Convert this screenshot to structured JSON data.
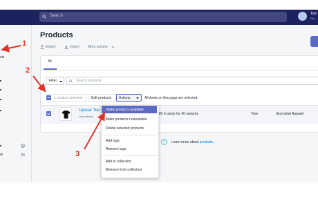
{
  "topbar": {
    "search_placeholder": "Search",
    "user_name": "Tom",
    "user_shop": "Sky"
  },
  "sidebar": {
    "items": [
      {
        "label": "cts"
      },
      {
        "label": "re"
      }
    ]
  },
  "page": {
    "title": "Products",
    "export_label": "Export",
    "import_label": "Import",
    "more_actions_label": "More actions"
  },
  "tabs": [
    {
      "label": "All"
    }
  ],
  "filter": {
    "label": "Filter",
    "search_placeholder": "Search products"
  },
  "bulk": {
    "selected_count": "1 product selected",
    "edit_label": "Edit products",
    "actions_label": "Actions",
    "all_items_notice": "All items on this page are selected."
  },
  "product": {
    "name": "Upscar Tee",
    "status": "Unavailable",
    "stock": "200 in stock for 40 variants",
    "type": "Tees",
    "vendor": "Skyrocket Apparel"
  },
  "actions_menu": {
    "items": [
      "Make products available",
      "Make products unavailable",
      "Delete selected products",
      "Add tags",
      "Remove tags",
      "Add to collection",
      "Remove from collection"
    ]
  },
  "learn_more": {
    "prefix": "Learn more about ",
    "link": "products",
    "suffix": "."
  },
  "annotations": {
    "markers": [
      "1",
      "2",
      "3"
    ]
  },
  "colors": {
    "topbar": "#1c2260",
    "accent": "#5c6ac4",
    "link": "#007ace",
    "annotation": "#e0342b"
  }
}
